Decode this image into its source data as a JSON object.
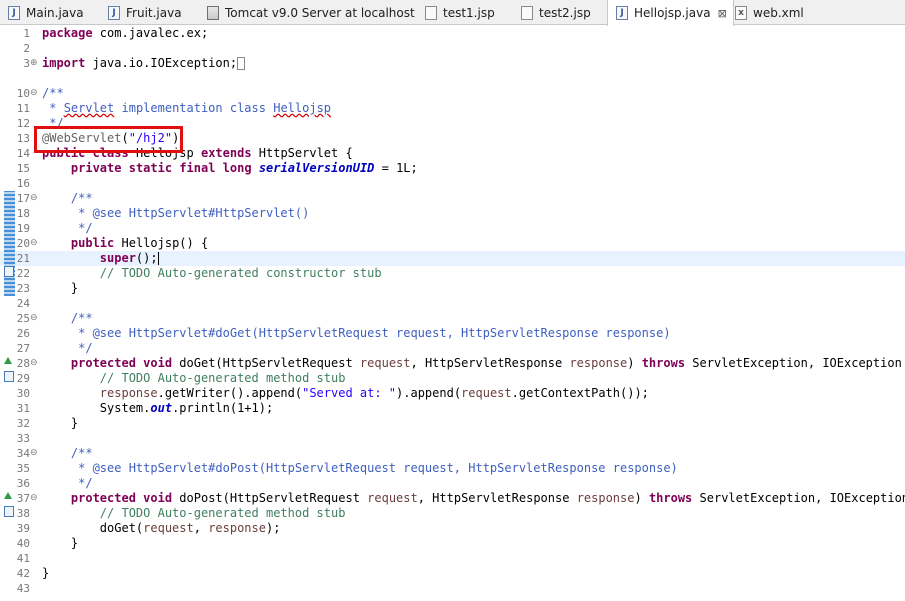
{
  "tabs": [
    {
      "label": "Main.java",
      "icon": "java-file-icon"
    },
    {
      "label": "Fruit.java",
      "icon": "java-file-icon"
    },
    {
      "label": "Tomcat v9.0 Server at localhost",
      "icon": "server-icon"
    },
    {
      "label": "test1.jsp",
      "icon": "jsp-file-icon"
    },
    {
      "label": "test2.jsp",
      "icon": "jsp-file-icon"
    },
    {
      "label": "Hellojsp.java",
      "icon": "java-file-icon",
      "active": true,
      "close": "⊠"
    },
    {
      "label": "web.xml",
      "icon": "xml-file-icon"
    }
  ],
  "editor": {
    "current_line": "21",
    "lines": [
      {
        "num": "1",
        "code": "package com.javalec.ex;"
      },
      {
        "num": "2",
        "code": ""
      },
      {
        "num": "3",
        "code": "import java.io.IOException;"
      },
      {
        "num": "10",
        "code": "/**"
      },
      {
        "num": "11",
        "code": " * Servlet implementation class Hellojsp"
      },
      {
        "num": "12",
        "code": " */"
      },
      {
        "num": "13",
        "code": "@WebServlet(\"/hj2\")"
      },
      {
        "num": "14",
        "code": "public class Hellojsp extends HttpServlet {"
      },
      {
        "num": "15",
        "code": "    private static final long serialVersionUID = 1L;"
      },
      {
        "num": "16",
        "code": ""
      },
      {
        "num": "17",
        "code": "    /**"
      },
      {
        "num": "18",
        "code": "     * @see HttpServlet#HttpServlet()"
      },
      {
        "num": "19",
        "code": "     */"
      },
      {
        "num": "20",
        "code": "    public Hellojsp() {"
      },
      {
        "num": "21",
        "code": "        super();"
      },
      {
        "num": "22",
        "code": "        // TODO Auto-generated constructor stub"
      },
      {
        "num": "23",
        "code": "    }"
      },
      {
        "num": "24",
        "code": ""
      },
      {
        "num": "25",
        "code": "    /**"
      },
      {
        "num": "26",
        "code": "     * @see HttpServlet#doGet(HttpServletRequest request, HttpServletResponse response)"
      },
      {
        "num": "27",
        "code": "     */"
      },
      {
        "num": "28",
        "code": "    protected void doGet(HttpServletRequest request, HttpServletResponse response) throws ServletException, IOException {"
      },
      {
        "num": "29",
        "code": "        // TODO Auto-generated method stub"
      },
      {
        "num": "30",
        "code": "        response.getWriter().append(\"Served at: \").append(request.getContextPath());"
      },
      {
        "num": "31",
        "code": "        System.out.println(1+1);"
      },
      {
        "num": "32",
        "code": "    }"
      },
      {
        "num": "33",
        "code": ""
      },
      {
        "num": "34",
        "code": "    /**"
      },
      {
        "num": "35",
        "code": "     * @see HttpServlet#doPost(HttpServletRequest request, HttpServletResponse response)"
      },
      {
        "num": "36",
        "code": "     */"
      },
      {
        "num": "37",
        "code": "    protected void doPost(HttpServletRequest request, HttpServletResponse response) throws ServletException, IOException {"
      },
      {
        "num": "38",
        "code": "        // TODO Auto-generated method stub"
      },
      {
        "num": "39",
        "code": "        doGet(request, response);"
      },
      {
        "num": "40",
        "code": "    }"
      },
      {
        "num": "41",
        "code": ""
      },
      {
        "num": "42",
        "code": "}"
      },
      {
        "num": "43",
        "code": ""
      }
    ]
  },
  "colors": {
    "keyword": "#7f0055",
    "comment": "#3f7f5f",
    "javadoc": "#3f5fbf",
    "string": "#2a00ff",
    "highlight_box": "#e01010"
  }
}
